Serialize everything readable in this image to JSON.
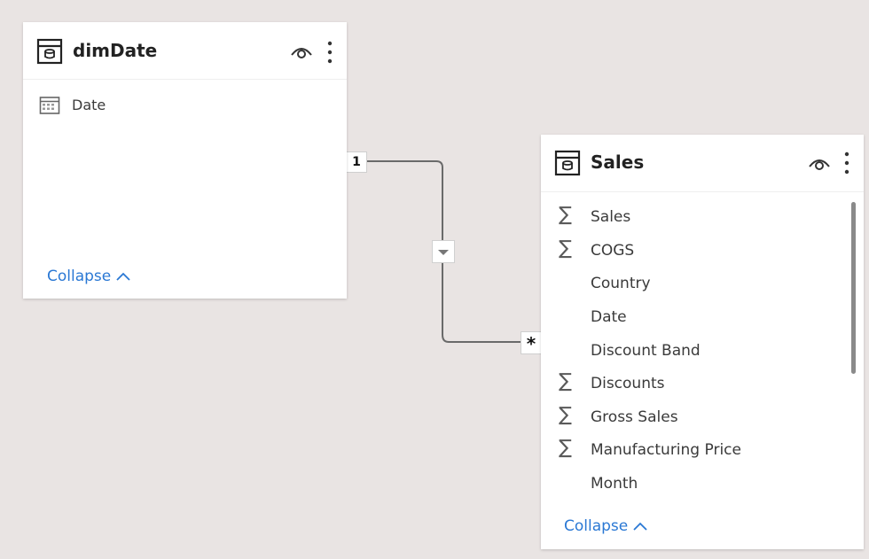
{
  "canvas_background": "#e9e4e3",
  "accent_color": "#2a78d4",
  "tables": {
    "dimDate": {
      "title": "dimDate",
      "fields": [
        {
          "icon": "calendar-icon",
          "label": "Date"
        }
      ],
      "collapse_label": "Collapse"
    },
    "sales": {
      "title": "Sales",
      "fields": [
        {
          "icon": "sigma-icon",
          "label": "Sales"
        },
        {
          "icon": "sigma-icon",
          "label": "COGS"
        },
        {
          "icon": "",
          "label": "Country"
        },
        {
          "icon": "",
          "label": "Date"
        },
        {
          "icon": "",
          "label": "Discount Band"
        },
        {
          "icon": "sigma-icon",
          "label": "Discounts"
        },
        {
          "icon": "sigma-icon",
          "label": "Gross Sales"
        },
        {
          "icon": "sigma-icon",
          "label": "Manufacturing Price"
        },
        {
          "icon": "",
          "label": "Month"
        }
      ],
      "collapse_label": "Collapse"
    }
  },
  "relationship": {
    "from_cardinality": "1",
    "to_cardinality": "*",
    "filter_direction_icon": "triangle-down-icon"
  }
}
